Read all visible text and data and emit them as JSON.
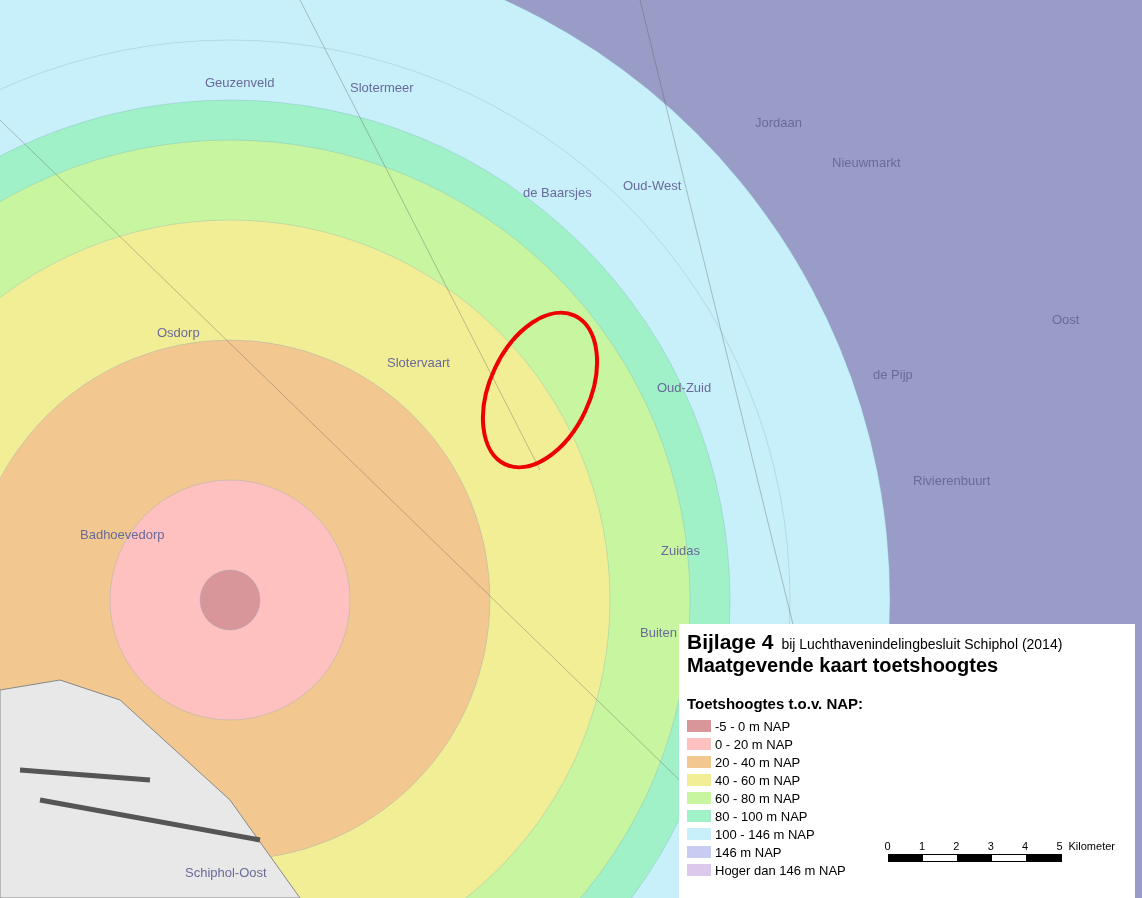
{
  "map": {
    "places": [
      "Geuzenveld",
      "Slotermeer",
      "Jordaan",
      "Nieuwmarkt",
      "de Baarsjes",
      "Oud-West",
      "Osdorp",
      "Slotervaart",
      "Oud-Zuid",
      "de Pijp",
      "Oost",
      "Rivierenbuurt",
      "Badhoevedorp",
      "Zuidas",
      "Buiten",
      "Schiphol-Oost"
    ]
  },
  "legend": {
    "annex": "Bijlage 4",
    "subtitle": "bij Luchthavenindelingbesluit Schiphol (2014)",
    "title": "Maatgevende kaart toetshoogtes",
    "heading": "Toetshoogtes t.o.v. NAP:",
    "items": [
      {
        "label": "-5 - 0 m NAP",
        "color": "#d9969a"
      },
      {
        "label": "0 - 20 m NAP",
        "color": "#ffc0c0"
      },
      {
        "label": "20 - 40 m NAP",
        "color": "#f2c890"
      },
      {
        "label": "40 - 60 m NAP",
        "color": "#f2ee96"
      },
      {
        "label": "60 - 80 m NAP",
        "color": "#c8f5a0"
      },
      {
        "label": "80 - 100 m NAP",
        "color": "#a0f0c8"
      },
      {
        "label": "100 - 146 m NAP",
        "color": "#c8f0fa"
      },
      {
        "label": "146 m NAP",
        "color": "#c8ccf2"
      },
      {
        "label": "Hoger dan 146 m NAP",
        "color": "#dcc8eb"
      }
    ],
    "scale": {
      "ticks": [
        "0",
        "1",
        "2",
        "3",
        "4",
        "5"
      ],
      "unit": "Kilometer"
    }
  }
}
